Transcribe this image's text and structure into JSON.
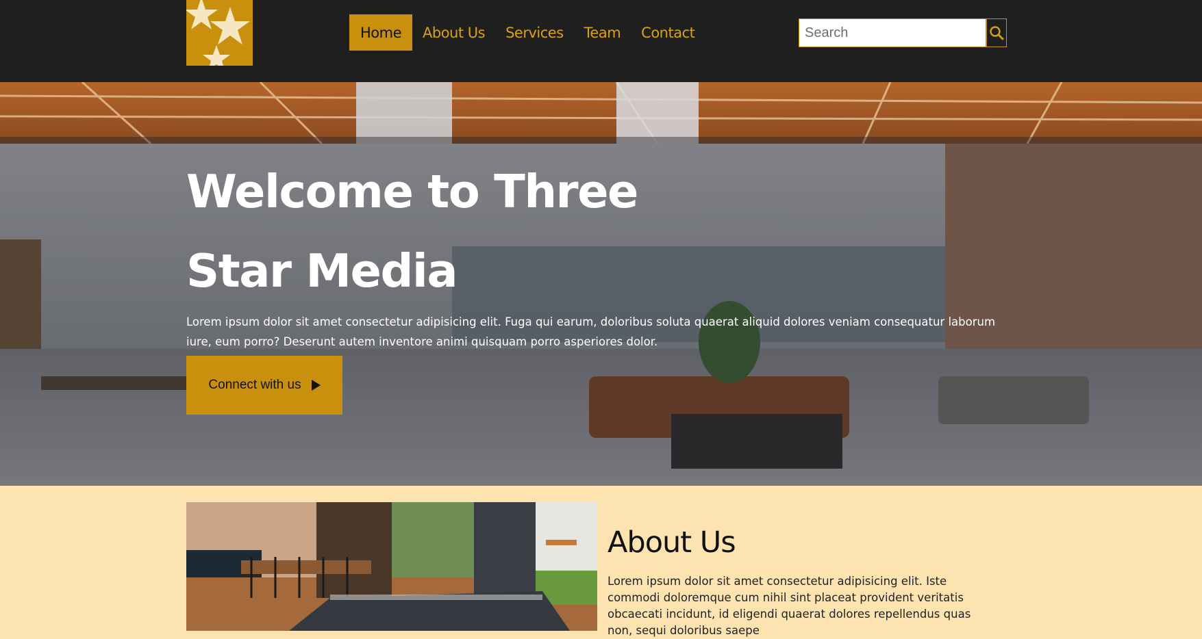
{
  "header": {
    "logo_alt": "Three Star Media logo",
    "nav": [
      {
        "label": "Home",
        "active": true
      },
      {
        "label": "About Us",
        "active": false
      },
      {
        "label": "Services",
        "active": false
      },
      {
        "label": "Team",
        "active": false
      },
      {
        "label": "Contact",
        "active": false
      }
    ],
    "search": {
      "placeholder": "Search",
      "value": "",
      "icon": "search-icon"
    }
  },
  "hero": {
    "title": "Welcome to Three Star Media",
    "text": "Lorem ipsum dolor sit amet consectetur adipisicing elit. Fuga qui earum, doloribus soluta quaerat aliquid dolores veniam consequatur laborum iure, eum porro? Deserunt autem inventore animi quisquam porro asperiores dolor.",
    "cta_label": "Connect with us",
    "cta_icon": "play-arrow-icon"
  },
  "about": {
    "title": "About Us",
    "text": "Lorem ipsum dolor sit amet consectetur adipisicing elit. Iste commodi doloremque cum nihil sint placeat provident veritatis obcaecati incidunt, id eligendi quaerat dolores repellendus quas non, sequi doloribus saepe"
  },
  "colors": {
    "header_bg": "#1f1f1f",
    "accent": "#c8900d",
    "nav_text": "#d9a30f",
    "about_bg": "#fde3b0"
  }
}
